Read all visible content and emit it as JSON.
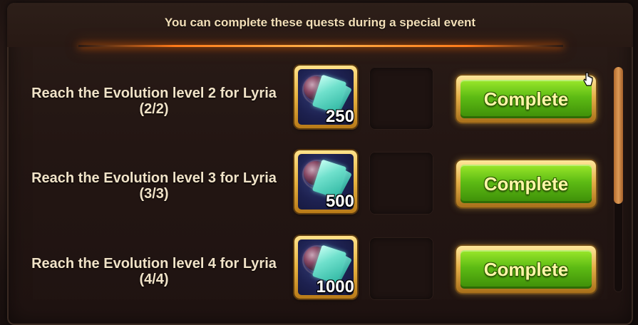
{
  "header": {
    "title": "You can complete these quests during a special event"
  },
  "quests": [
    {
      "line1": "Reach the Evolution level 2 for Lyria",
      "progress": "(2/2)",
      "reward_amount": "250",
      "button_label": "Complete"
    },
    {
      "line1": "Reach the Evolution level 3 for Lyria",
      "progress": "(3/3)",
      "reward_amount": "500",
      "button_label": "Complete"
    },
    {
      "line1": "Reach the Evolution level 4 for Lyria",
      "progress": "(4/4)",
      "reward_amount": "1000",
      "button_label": "Complete"
    }
  ],
  "icons": {
    "reward": "soul-stone-card-icon",
    "cursor": "hand-pointer-icon"
  },
  "colors": {
    "button_green": "#5dbb14",
    "button_text": "#fff6a8",
    "gold_frame": "#e4b048",
    "header_glow": "#ff7a1a",
    "scroll_thumb": "#dd9a55"
  }
}
